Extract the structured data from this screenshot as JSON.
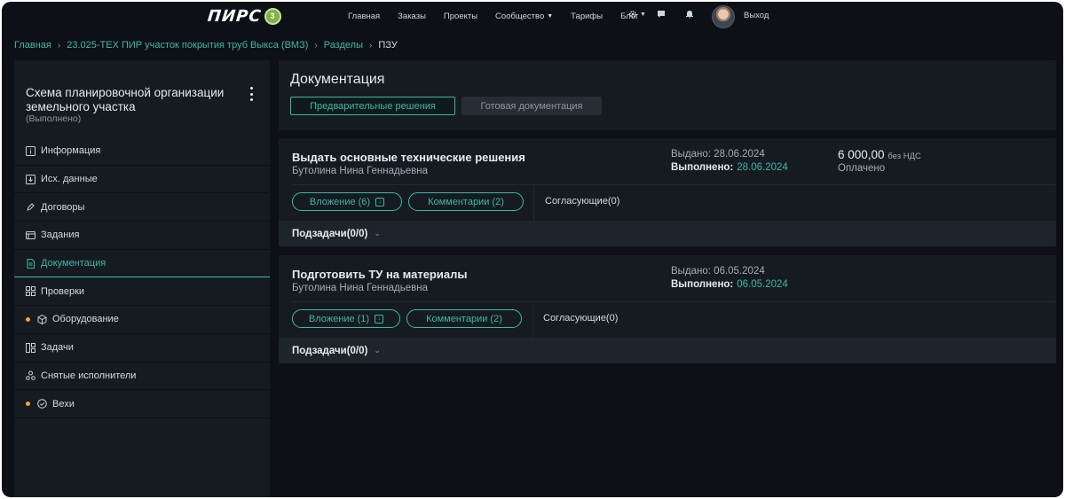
{
  "header": {
    "logo_text": "ПИРС",
    "logo_badge": "3",
    "nav": [
      "Главная",
      "Заказы",
      "Проекты",
      "Сообщество",
      "Тарифы",
      "Блог"
    ],
    "logout": "Выход"
  },
  "breadcrumb": [
    "Главная",
    "23.025-ТЕХ ПИР участок покрытия труб Выкса (ВМЗ)",
    "Разделы",
    "ПЗУ"
  ],
  "sidebar": {
    "title": "Схема планировочной организации земельного участка",
    "status": "(Выполнено)",
    "items": [
      {
        "label": "Информация",
        "icon": "info-icon"
      },
      {
        "label": "Исх. данные",
        "icon": "download-icon"
      },
      {
        "label": "Договоры",
        "icon": "pen-icon"
      },
      {
        "label": "Задания",
        "icon": "window-icon"
      },
      {
        "label": "Документация",
        "icon": "document-icon",
        "active": true
      },
      {
        "label": "Проверки",
        "icon": "grid-icon"
      },
      {
        "label": "Оборудование",
        "icon": "box-icon",
        "dot": true
      },
      {
        "label": "Задачи",
        "icon": "board-icon"
      },
      {
        "label": "Снятые исполнители",
        "icon": "users-icon"
      },
      {
        "label": "Вехи",
        "icon": "check-circle-icon",
        "dot": true
      }
    ]
  },
  "main": {
    "title": "Документация",
    "tabs": [
      "Предварительные решения",
      "Готовая документация"
    ]
  },
  "cards": [
    {
      "title": "Выдать основные технические решения",
      "person": "Бутолина Нина Геннадьевна",
      "issued": "Выдано: 28.06.2024",
      "done_label": "Выполнено:",
      "done_date": "28.06.2024",
      "price": "6 000,00",
      "price_note": "без НДС",
      "paid": "Оплачено",
      "attachments": "Вложение (6)",
      "comments": "Комментарии (2)",
      "approvers": "Согласующие(0)",
      "subtasks": "Подзадачи(0/0)"
    },
    {
      "title": "Подготовить ТУ на материалы",
      "person": "Бутолина Нина Геннадьевна",
      "issued": "Выдано: 06.05.2024",
      "done_label": "Выполнено:",
      "done_date": "06.05.2024",
      "attachments": "Вложение (1)",
      "comments": "Комментарии (2)",
      "approvers": "Согласующие(0)",
      "subtasks": "Подзадачи(0/0)"
    }
  ],
  "colors": {
    "accent": "#3fb8a4",
    "background": "#0d1117",
    "panel": "#161b22",
    "dot": "#f0a92e"
  }
}
